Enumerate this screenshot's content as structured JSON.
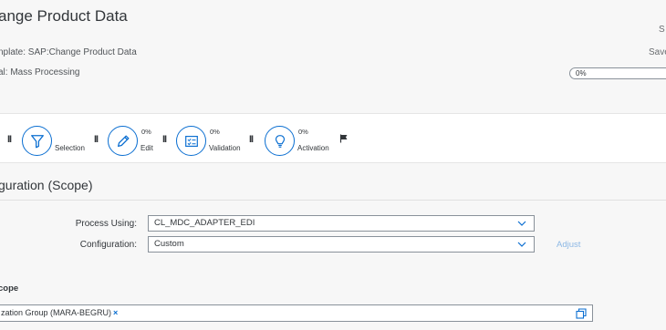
{
  "header": {
    "title": "ange Product Data",
    "template_label": "nplate: SAP:Change Product Data",
    "process_label": "al: Mass Processing",
    "status_short": "S",
    "save_label": "Save",
    "progress_value": "0%"
  },
  "steps": [
    {
      "label": "Selection",
      "percent": "",
      "icon": "filter-icon"
    },
    {
      "label": "Edit",
      "percent": "0%",
      "icon": "pencil-icon"
    },
    {
      "label": "Validation",
      "percent": "0%",
      "icon": "checklist-icon"
    },
    {
      "label": "Activation",
      "percent": "0%",
      "icon": "lightbulb-icon"
    }
  ],
  "pause_glyph": "II",
  "section": {
    "title": "guration (Scope)"
  },
  "form": {
    "process_using_label": "Process Using:",
    "process_using_value": "CL_MDC_ADAPTER_EDI",
    "configuration_label": "Configuration:",
    "configuration_value": "Custom",
    "adjust_label": "Adjust"
  },
  "scope": {
    "heading": "cope",
    "token_label": "zation Group (MARA-BEGRU)",
    "token_remove": "×"
  },
  "colors": {
    "accent": "#0a6ed1",
    "link_disabled": "#8db8e5",
    "background": "#f7f7f7"
  }
}
